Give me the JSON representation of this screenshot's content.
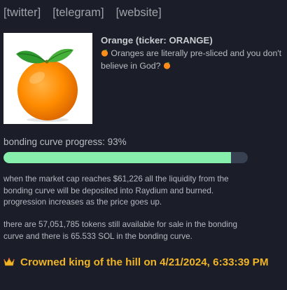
{
  "links": {
    "twitter": "[twitter]",
    "telegram": "[telegram]",
    "website": "[website]"
  },
  "token": {
    "name": "Orange (ticker: ORANGE)",
    "description": "Oranges are literally pre-sliced and you don't believe in God?"
  },
  "progress": {
    "label": "bonding curve progress: 93%",
    "value": 0.93,
    "fill_color": "#86efac",
    "track_color": "#374151"
  },
  "info": {
    "market_cap_text": "when the market cap reaches $61,226 all the liquidity from the bonding curve will be deposited into Raydium and burned. progression increases as the price goes up.",
    "tokens_text": "there are 57,051,785 tokens still available for sale in the bonding curve and there is 65.533 SOL in the bonding curve."
  },
  "king_of_hill": {
    "text": "Crowned king of the hill on 4/21/2024, 6:33:39 PM",
    "icon": "crown-icon",
    "color": "#f0b428"
  },
  "colors": {
    "background": "#1b1d28",
    "text": "#b4b8bf"
  }
}
